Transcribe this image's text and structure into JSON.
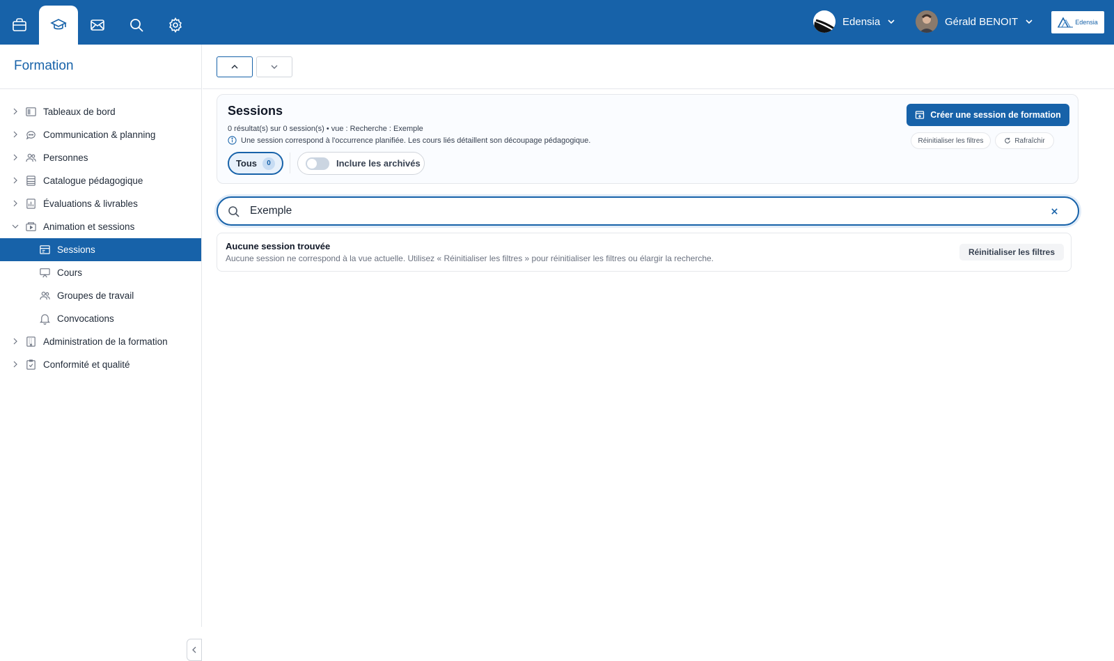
{
  "topbar": {
    "tabs": [
      {
        "icon": "briefcase-icon"
      },
      {
        "icon": "graduation-cap-icon",
        "active": true
      },
      {
        "icon": "mail-icon"
      },
      {
        "icon": "search-icon"
      },
      {
        "icon": "gear-icon"
      }
    ],
    "org_name": "Edensia",
    "user_name": "Gérald BENOIT",
    "brand_text": "Edensia"
  },
  "sidebar": {
    "title": "Formation",
    "items": [
      {
        "label": "Tableaux de bord",
        "icon": "dashboard-icon"
      },
      {
        "label": "Communication & planning",
        "icon": "chat-icon"
      },
      {
        "label": "Personnes",
        "icon": "people-icon"
      },
      {
        "label": "Catalogue pédagogique",
        "icon": "catalog-icon"
      },
      {
        "label": "Évaluations & livrables",
        "icon": "evaluation-icon"
      },
      {
        "label": "Animation et sessions",
        "icon": "animation-icon",
        "expanded": true
      },
      {
        "label": "Sessions",
        "icon": "calendar-icon",
        "sub": true,
        "active": true
      },
      {
        "label": "Cours",
        "icon": "presentation-icon",
        "sub": true
      },
      {
        "label": "Groupes de travail",
        "icon": "group-icon",
        "sub": true
      },
      {
        "label": "Convocations",
        "icon": "bell-icon",
        "sub": true
      },
      {
        "label": "Administration de la formation",
        "icon": "building-icon"
      },
      {
        "label": "Conformité et qualité",
        "icon": "clipboard-check-icon"
      }
    ]
  },
  "sessions": {
    "title": "Sessions",
    "meta": "0 résultat(s) sur 0 session(s) • vue : Recherche : Exemple",
    "info": "Une session correspond à l'occurrence planifiée. Les cours liés détaillent son découpage pédagogique.",
    "filter_all_label": "Tous",
    "filter_all_count": "0",
    "archived_label": "Inclure les archivés",
    "archived_on": false,
    "create_button": "Créer une session de formation",
    "reset_button": "Réinitialiser les filtres",
    "refresh_button": "Rafraîchir"
  },
  "search": {
    "value": "Exemple"
  },
  "empty_state": {
    "title": "Aucune session trouvée",
    "description": "Aucune session ne correspond à la vue actuelle. Utilisez « Réinitialiser les filtres » pour réinitialiser les filtres ou élargir la recherche.",
    "reset_button": "Réinitialiser les filtres"
  },
  "colors": {
    "brand_blue": "#1762a9",
    "border": "#e5e7eb",
    "active_chip_bg": "#e8f1fb"
  }
}
